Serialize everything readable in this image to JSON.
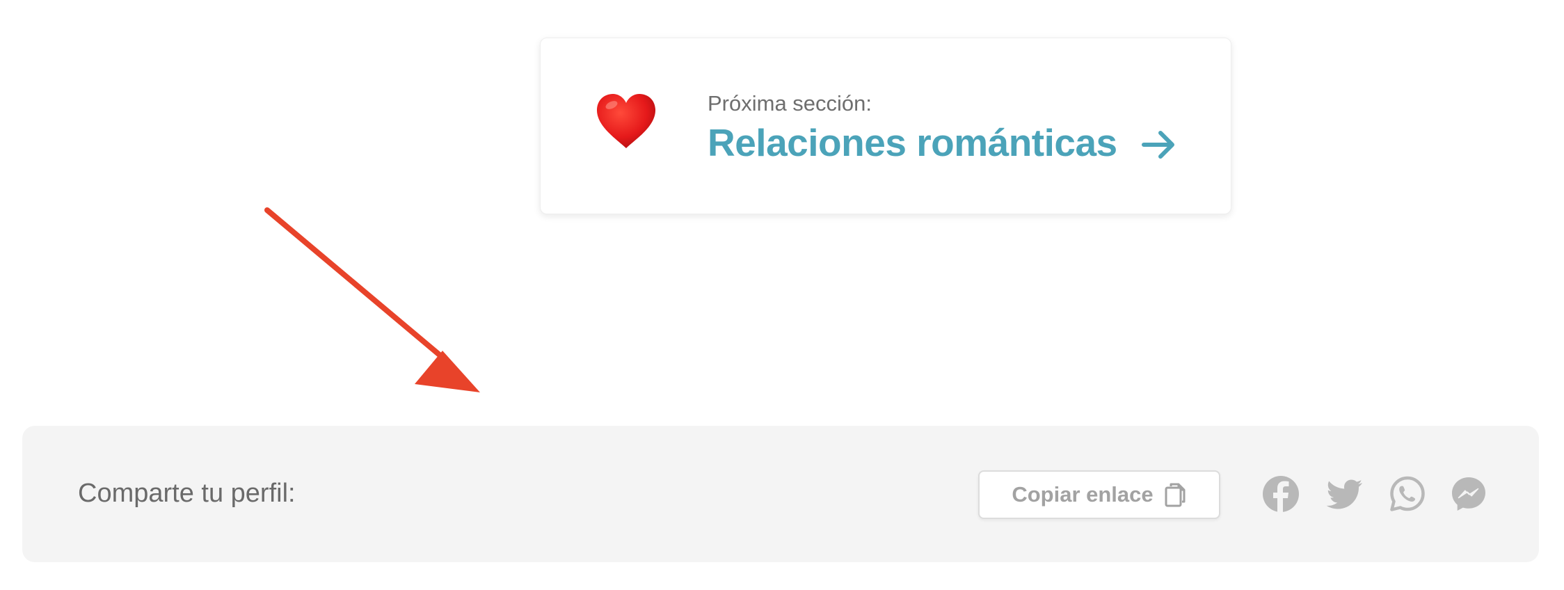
{
  "next_section": {
    "label": "Próxima sección:",
    "title": "Relaciones románticas",
    "emoji_icon": "red-heart-icon",
    "arrow_icon": "arrow-right-icon",
    "accent_color": "#4ba3b9"
  },
  "annotation": {
    "arrow_icon": "pointer-arrow-icon",
    "color": "#e8432a"
  },
  "share": {
    "label": "Comparte tu perfil:",
    "copy_button": {
      "label": "Copiar enlace",
      "icon": "copy-icon"
    },
    "social": [
      {
        "name": "facebook",
        "icon": "facebook-icon"
      },
      {
        "name": "twitter",
        "icon": "twitter-icon"
      },
      {
        "name": "whatsapp",
        "icon": "whatsapp-icon"
      },
      {
        "name": "messenger",
        "icon": "messenger-icon"
      }
    ],
    "icon_color": "#b8b8b8",
    "background_color": "#f4f4f4"
  }
}
